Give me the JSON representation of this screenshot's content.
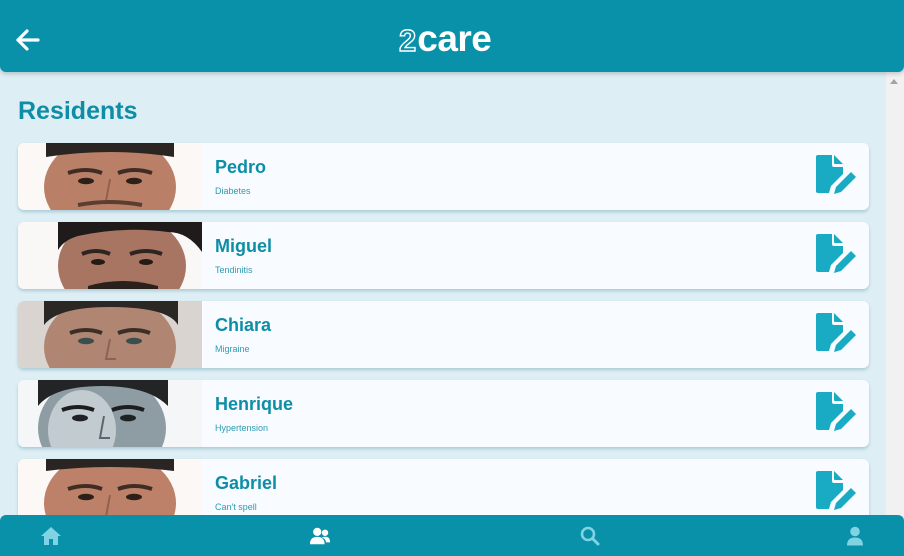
{
  "app": {
    "logo_number": "2",
    "logo_word": "care"
  },
  "header": {
    "back_icon": "arrow-left-icon"
  },
  "page": {
    "title": "Residents"
  },
  "residents": [
    {
      "name": "Pedro",
      "condition": "Diabetes"
    },
    {
      "name": "Miguel",
      "condition": "Tendinitis"
    },
    {
      "name": "Chiara",
      "condition": "Migraine"
    },
    {
      "name": "Henrique",
      "condition": "Hypertension"
    },
    {
      "name": "Gabriel",
      "condition": "Can't spell"
    }
  ],
  "bottom_nav": {
    "items": [
      {
        "icon": "home-icon",
        "active": false
      },
      {
        "icon": "users-icon",
        "active": true
      },
      {
        "icon": "search-icon",
        "active": false
      },
      {
        "icon": "user-icon",
        "active": false
      }
    ]
  },
  "colors": {
    "primary": "#0891a8",
    "background": "#deeef5",
    "card": "#f8fbff",
    "title": "#0d8ea6",
    "edit_icon": "#1aabc4",
    "nav_inactive": "#7fd3e2"
  }
}
